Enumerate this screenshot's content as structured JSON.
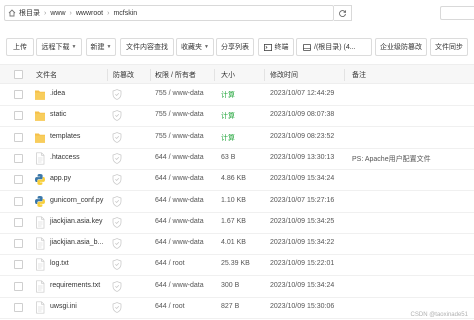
{
  "breadcrumb": [
    "根目录",
    "www",
    "wwwroot",
    "mcfskin"
  ],
  "toolbar": {
    "upload": "上传",
    "remote_download": "远程下载",
    "new": "新建",
    "file_search": "文件内容查找",
    "favorites": "收藏夹",
    "share_list": "分享列表",
    "terminal": "终端",
    "path_tab": "/(根目录) (4...",
    "enterprise_backup": "企业级防篡改",
    "file_sync": "文件同步"
  },
  "columns": {
    "name": "文件名",
    "protect": "防篡改",
    "perm": "权限 / 所有者",
    "size": "大小",
    "mtime": "修改时间",
    "note": "备注"
  },
  "files": [
    {
      "name": ".idea",
      "icon": "folder-icon",
      "perm": "755 / www-data",
      "size": "计算",
      "mtime": "2023/10/07 12:44:29",
      "note": ""
    },
    {
      "name": "static",
      "icon": "folder-icon",
      "perm": "755 / www-data",
      "size": "计算",
      "mtime": "2023/10/09 08:07:38",
      "note": ""
    },
    {
      "name": "templates",
      "icon": "folder-icon",
      "perm": "755 / www-data",
      "size": "计算",
      "mtime": "2023/10/09 08:23:52",
      "note": ""
    },
    {
      "name": ".htaccess",
      "icon": "file-icon",
      "perm": "644 / www-data",
      "size": "63 B",
      "mtime": "2023/10/09 13:30:13",
      "note": "PS: Apache用户配置文件"
    },
    {
      "name": "app.py",
      "icon": "python-icon",
      "perm": "644 / www-data",
      "size": "4.86 KB",
      "mtime": "2023/10/09 15:34:24",
      "note": ""
    },
    {
      "name": "gunicorn_conf.py",
      "icon": "python-icon",
      "perm": "644 / www-data",
      "size": "1.10 KB",
      "mtime": "2023/10/07 15:27:16",
      "note": ""
    },
    {
      "name": "jiackjian.asia.key",
      "icon": "file-icon",
      "perm": "644 / www-data",
      "size": "1.67 KB",
      "mtime": "2023/10/09 15:34:25",
      "note": ""
    },
    {
      "name": "jiackjian.asia_b...",
      "icon": "file-icon",
      "perm": "644 / www-data",
      "size": "4.01 KB",
      "mtime": "2023/10/09 15:34:22",
      "note": ""
    },
    {
      "name": "log.txt",
      "icon": "file-icon",
      "perm": "644 / root",
      "size": "25.39 KB",
      "mtime": "2023/10/09 15:22:01",
      "note": ""
    },
    {
      "name": "requirements.txt",
      "icon": "file-icon",
      "perm": "644 / www-data",
      "size": "300 B",
      "mtime": "2023/10/09 15:34:24",
      "note": ""
    },
    {
      "name": "uwsgi.ini",
      "icon": "file-icon",
      "perm": "644 / root",
      "size": "827 B",
      "mtime": "2023/10/09 15:30:06",
      "note": ""
    }
  ],
  "colors": {
    "green": "#20a53a",
    "folder": "#f5c04a",
    "python_blue": "#3b77a8",
    "python_yellow": "#f7cf3d"
  },
  "watermark": "CSDN @taoxinade51"
}
